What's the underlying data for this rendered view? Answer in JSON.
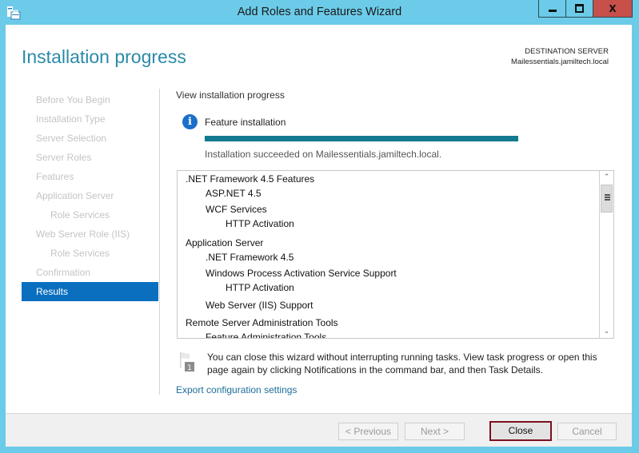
{
  "window": {
    "title": "Add Roles and Features Wizard",
    "app_icon": "server-manager-icon",
    "controls": {
      "minimize": "minimize-icon",
      "maximize": "maximize-icon",
      "close": "X"
    }
  },
  "header": {
    "page_title": "Installation progress",
    "destination_label": "DESTINATION SERVER",
    "destination_server": "Mailessentials.jamiltech.local"
  },
  "sidebar": {
    "items": [
      {
        "label": "Before You Begin",
        "level": 0,
        "active": false
      },
      {
        "label": "Installation Type",
        "level": 0,
        "active": false
      },
      {
        "label": "Server Selection",
        "level": 0,
        "active": false
      },
      {
        "label": "Server Roles",
        "level": 0,
        "active": false
      },
      {
        "label": "Features",
        "level": 0,
        "active": false
      },
      {
        "label": "Application Server",
        "level": 0,
        "active": false
      },
      {
        "label": "Role Services",
        "level": 1,
        "active": false
      },
      {
        "label": "Web Server Role (IIS)",
        "level": 0,
        "active": false
      },
      {
        "label": "Role Services",
        "level": 1,
        "active": false
      },
      {
        "label": "Confirmation",
        "level": 0,
        "active": false
      },
      {
        "label": "Results",
        "level": 0,
        "active": true
      }
    ]
  },
  "main": {
    "section_label": "View installation progress",
    "status_icon": "info-icon",
    "status_title": "Feature installation",
    "progress_percent": 100,
    "status_message": "Installation succeeded on Mailessentials.jamiltech.local.",
    "features": [
      {
        "label": ".NET Framework 4.5 Features",
        "level": 0
      },
      {
        "label": "ASP.NET 4.5",
        "level": 1
      },
      {
        "label": "WCF Services",
        "level": 1
      },
      {
        "label": "HTTP Activation",
        "level": 2
      },
      {
        "label": "Application Server",
        "level": 0
      },
      {
        "label": ".NET Framework 4.5",
        "level": 1
      },
      {
        "label": "Windows Process Activation Service Support",
        "level": 1
      },
      {
        "label": "HTTP Activation",
        "level": 2
      },
      {
        "label": "Web Server (IIS) Support",
        "level": 1
      },
      {
        "label": "Remote Server Administration Tools",
        "level": 0
      },
      {
        "label": "Feature Administration Tools",
        "level": 1
      }
    ],
    "notification_badge": "1",
    "note": "You can close this wizard without interrupting running tasks. View task progress or open this page again by clicking Notifications in the command bar, and then Task Details.",
    "export_link": "Export configuration settings"
  },
  "footer": {
    "previous_label": "< Previous",
    "next_label": "Next >",
    "close_label": "Close",
    "cancel_label": "Cancel"
  },
  "colors": {
    "frame": "#6ccbe8",
    "accent": "#0a6fbf",
    "heading": "#2a8aa8",
    "progress": "#137a90",
    "close_window": "#c7504a",
    "default_button_border": "#7b1020"
  }
}
